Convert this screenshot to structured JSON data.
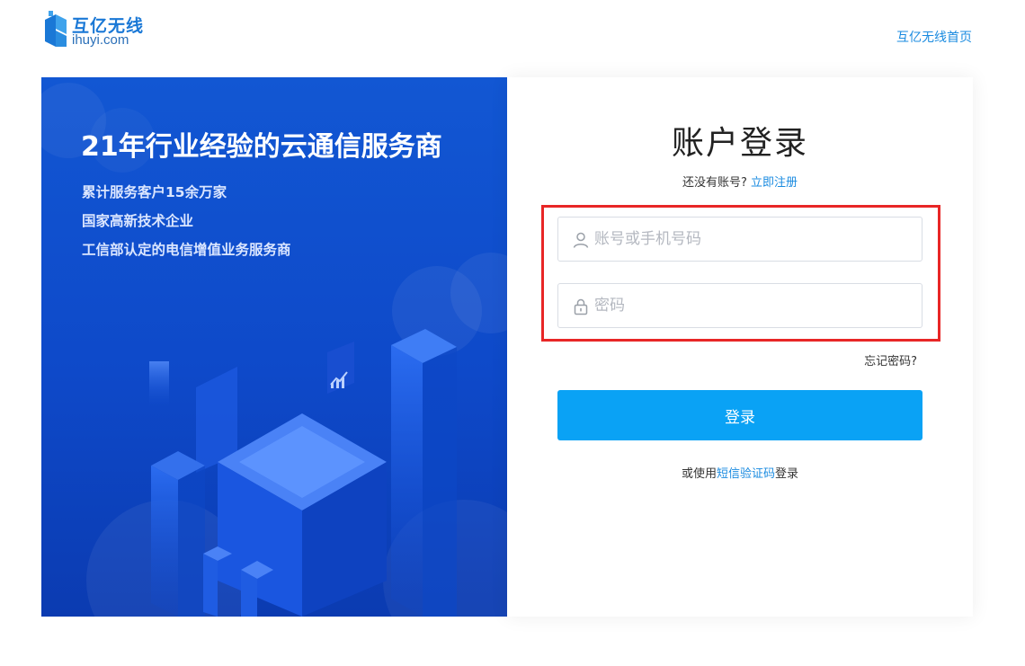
{
  "header": {
    "brand_cn": "互亿无线",
    "brand_en": "ihuyi.com",
    "home_link": "互亿无线首页"
  },
  "banner": {
    "title": "21年行业经验的云通信服务商",
    "features": [
      "累计服务客户15余万家",
      "国家高新技术企业",
      "工信部认定的电信增值业务服务商"
    ]
  },
  "login": {
    "title": "账户登录",
    "no_account_text": "还没有账号?",
    "register_link": "立即注册",
    "username_placeholder": "账号或手机号码",
    "password_placeholder": "密码",
    "forgot_password": "忘记密码?",
    "submit_label": "登录",
    "sms_prefix": "或使用",
    "sms_link": "短信验证码",
    "sms_suffix": "登录"
  },
  "colors": {
    "brand_blue": "#1a78d6",
    "link_blue": "#1a8be0",
    "button_blue": "#0aa2f5",
    "highlight_red": "#e82626",
    "banner_blue": "#1257d3"
  },
  "icons": [
    "logo-mark",
    "user-icon",
    "lock-icon",
    "chart-icon"
  ]
}
